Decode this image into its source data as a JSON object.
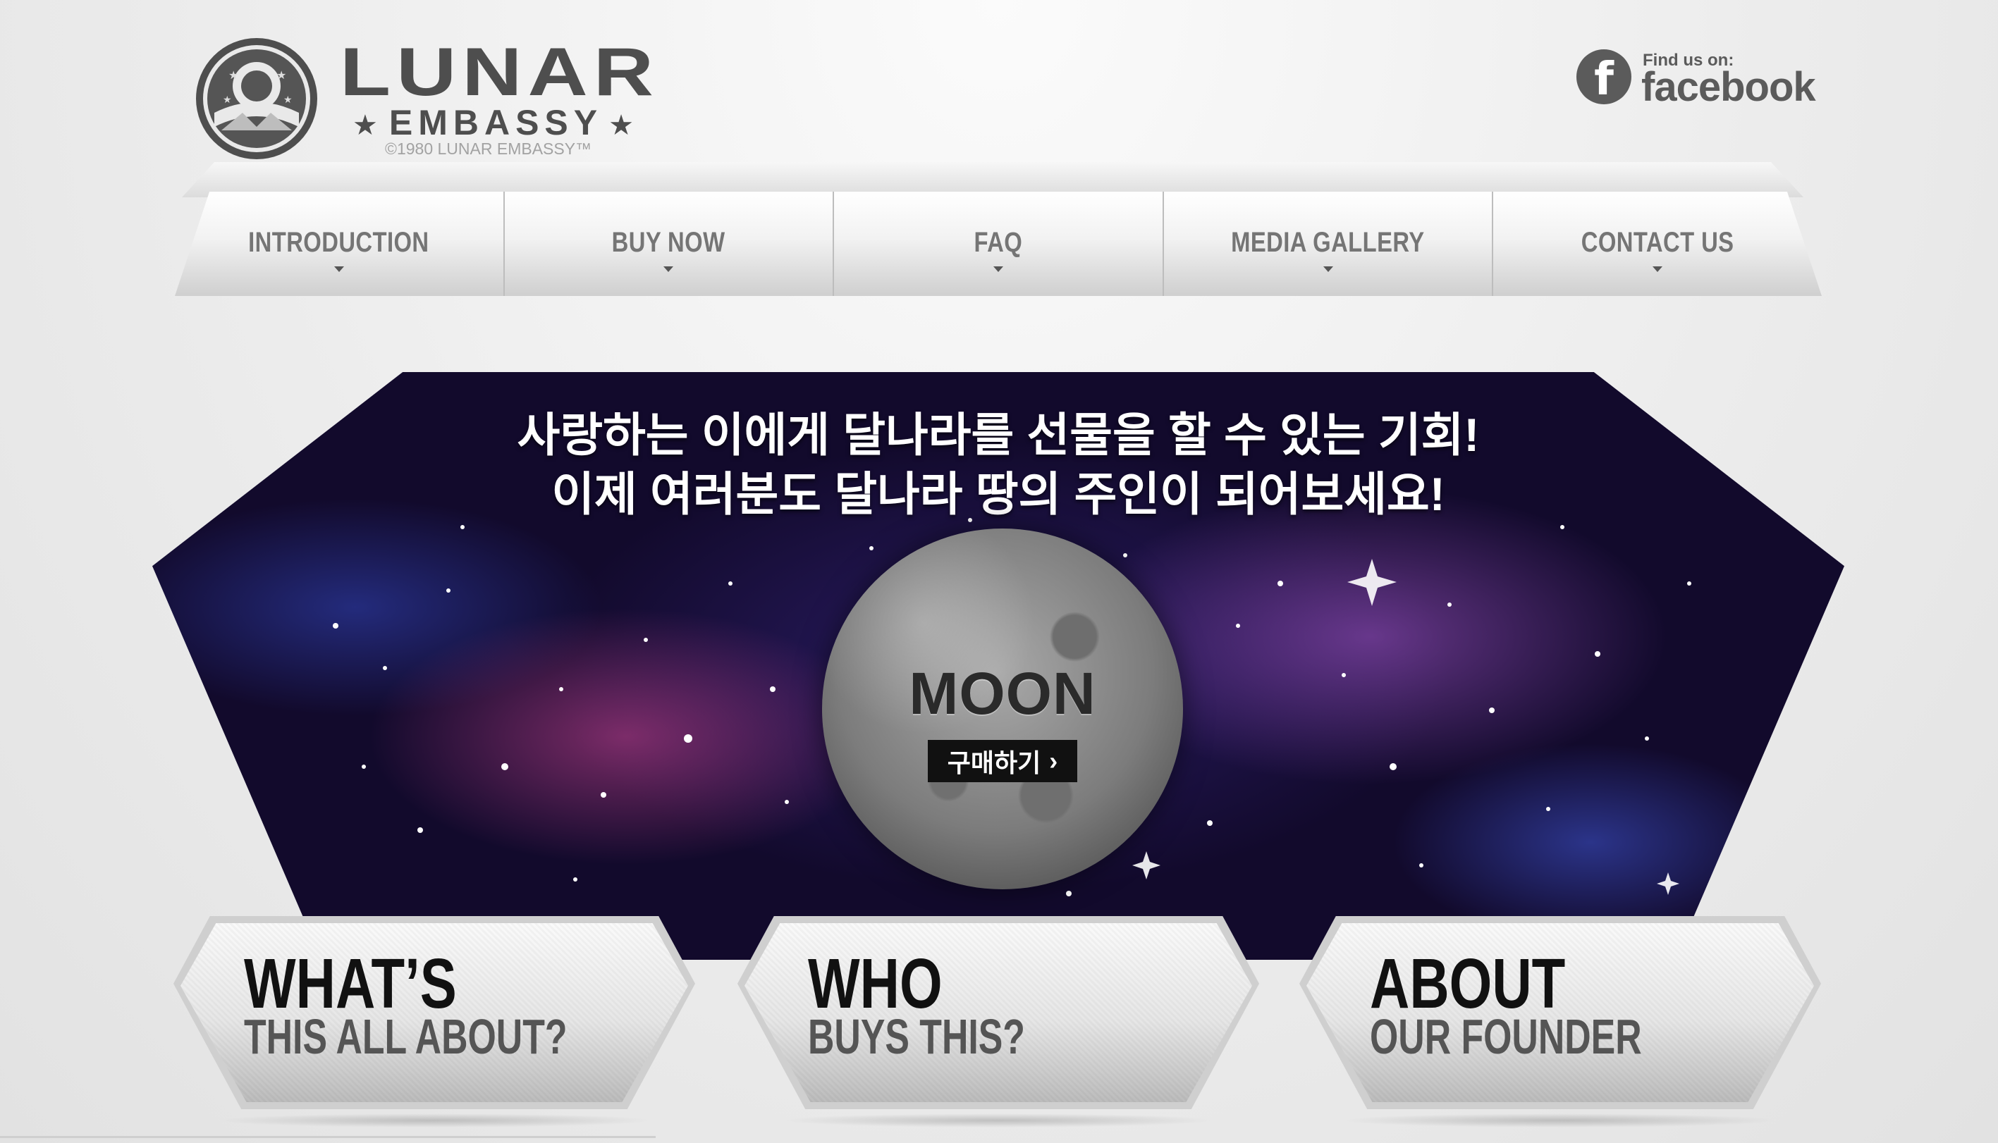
{
  "logo": {
    "word": "LUNAR",
    "sub": "EMBASSY",
    "copyright": "©1980 LUNAR EMBASSY™"
  },
  "facebook": {
    "find_label": "Find us on:",
    "brand": "facebook",
    "icon": "facebook-icon"
  },
  "nav": {
    "items": [
      {
        "label": "INTRODUCTION"
      },
      {
        "label": "BUY NOW"
      },
      {
        "label": "FAQ"
      },
      {
        "label": "MEDIA GALLERY"
      },
      {
        "label": "CONTACT US"
      }
    ]
  },
  "hero": {
    "line1": "사랑하는 이에게 달나라를 선물을 할 수 있는 기회!",
    "line2": "이제 여러분도 달나라 땅의 주인이 되어보세요!",
    "moon_title": "MOON",
    "buy_label": "구매하기",
    "buy_icon": "›"
  },
  "cards": [
    {
      "title": "WHAT’S",
      "sub": "THIS ALL ABOUT?"
    },
    {
      "title": "WHO",
      "sub": "BUYS THIS?"
    },
    {
      "title": "ABOUT",
      "sub": "OUR FOUNDER"
    }
  ],
  "colors": {
    "page_background": "#ececec",
    "text_dark": "#4e4e4e",
    "nav_text": "#757575",
    "hero_text": "#ffffff",
    "button_bg": "#111111"
  }
}
